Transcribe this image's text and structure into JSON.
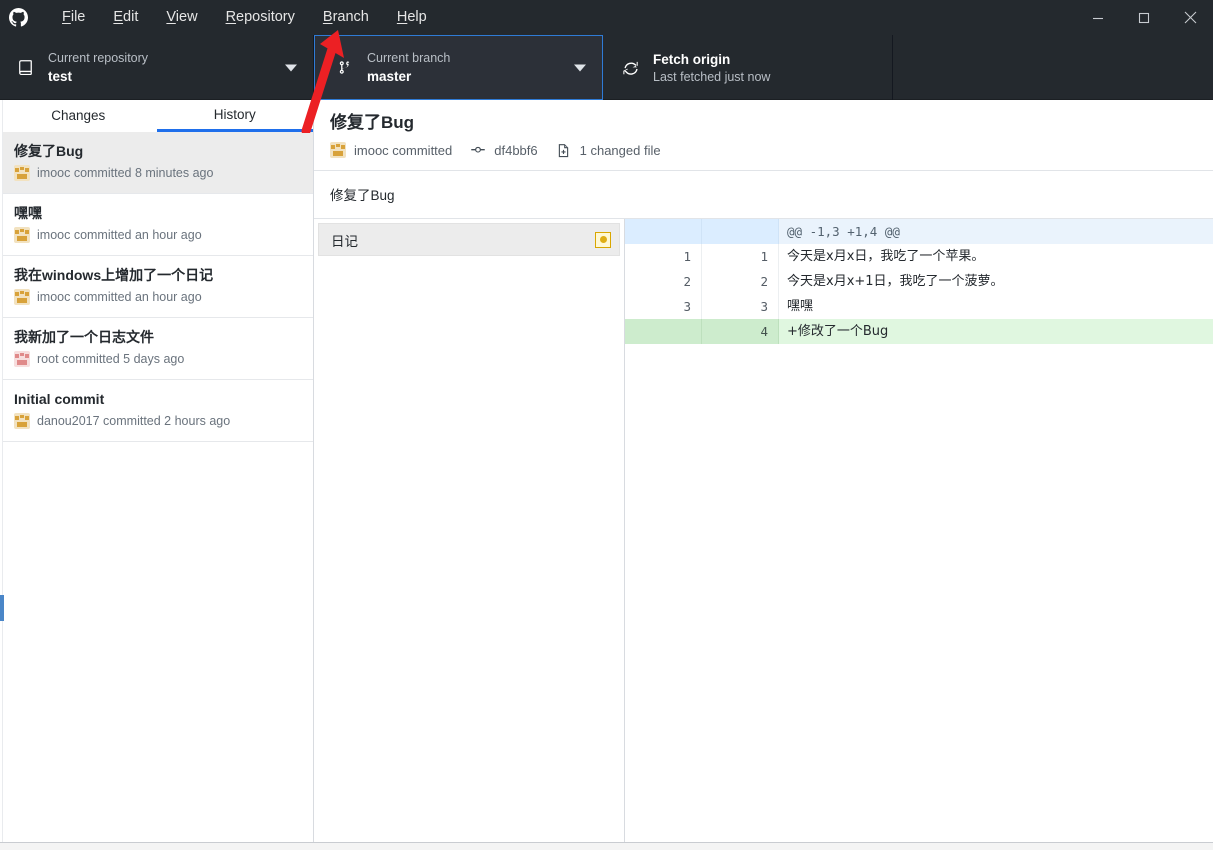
{
  "window": {
    "app_name": "GitHub Desktop",
    "logo_icon": "github-mark-icon",
    "controls": {
      "minimize": "minimize-icon",
      "maximize": "maximize-icon",
      "close": "close-icon"
    }
  },
  "menubar": {
    "items": [
      {
        "label": "File",
        "mnemonic": "F",
        "rest": "ile"
      },
      {
        "label": "Edit",
        "mnemonic": "E",
        "rest": "dit"
      },
      {
        "label": "View",
        "mnemonic": "V",
        "rest": "iew"
      },
      {
        "label": "Repository",
        "mnemonic": "R",
        "rest": "epository"
      },
      {
        "label": "Branch",
        "mnemonic": "B",
        "rest": "ranch"
      },
      {
        "label": "Help",
        "mnemonic": "H",
        "rest": "elp"
      }
    ]
  },
  "toolbar": {
    "repository": {
      "label": "Current repository",
      "value": "test",
      "icon": "repo-book-icon",
      "caret": "chevron-down-icon"
    },
    "branch": {
      "label": "Current branch",
      "value": "master",
      "icon": "git-branch-icon",
      "caret": "chevron-down-icon",
      "focus_color": "#2f7bd6"
    },
    "fetch": {
      "label": "Fetch origin",
      "value": "Last fetched just now",
      "icon": "sync-refresh-icon"
    }
  },
  "sidebar": {
    "tabs": [
      {
        "label": "Changes",
        "active": false
      },
      {
        "label": "History",
        "active": true
      }
    ],
    "active_tab_color": "#1f6feb",
    "commits": [
      {
        "title": "修复了Bug",
        "meta": "imooc committed 8 minutes ago",
        "avatar": "tan",
        "selected": true
      },
      {
        "title": "嘿嘿",
        "meta": "imooc committed an hour ago",
        "avatar": "tan",
        "selected": false
      },
      {
        "title": "我在windows上增加了一个日记",
        "meta": "imooc committed an hour ago",
        "avatar": "tan",
        "selected": false
      },
      {
        "title": "我新加了一个日志文件",
        "meta": "root committed 5 days ago",
        "avatar": "pink",
        "selected": false
      },
      {
        "title": "Initial commit",
        "meta": "danou2017 committed 2 hours ago",
        "avatar": "tan",
        "selected": false
      }
    ]
  },
  "detail": {
    "title": "修复了Bug",
    "author_avatar": "tan",
    "author_text": "imooc committed",
    "sha_icon": "git-commit-icon",
    "sha": "df4bbf6",
    "files_icon": "file-diff-icon",
    "files_text": "1 changed file",
    "description": "修复了Bug",
    "files": [
      {
        "name": "日记",
        "status": "modified",
        "status_icon": "modified-dot-icon"
      }
    ]
  },
  "diff": {
    "lines": [
      {
        "type": "hunk",
        "old": "",
        "new": "",
        "text": "@@ -1,3 +1,4 @@"
      },
      {
        "type": "ctx",
        "old": "1",
        "new": "1",
        "text": "今天是x月x日，我吃了一个苹果。"
      },
      {
        "type": "ctx",
        "old": "2",
        "new": "2",
        "text": "今天是x月x+1日，我吃了一个菠萝。"
      },
      {
        "type": "ctx",
        "old": "3",
        "new": "3",
        "text": "嘿嘿"
      },
      {
        "type": "add",
        "old": "",
        "new": "4",
        "text": "+修改了一个Bug"
      }
    ],
    "colors": {
      "hunk_bg": "#eaf3fc",
      "add_bg": "#e0f7e0",
      "add_gutter_bg": "#cdeccd"
    }
  },
  "annotation": {
    "arrow": "red-arrow-pointing-to-branch-menu",
    "color": "#ec2024"
  }
}
